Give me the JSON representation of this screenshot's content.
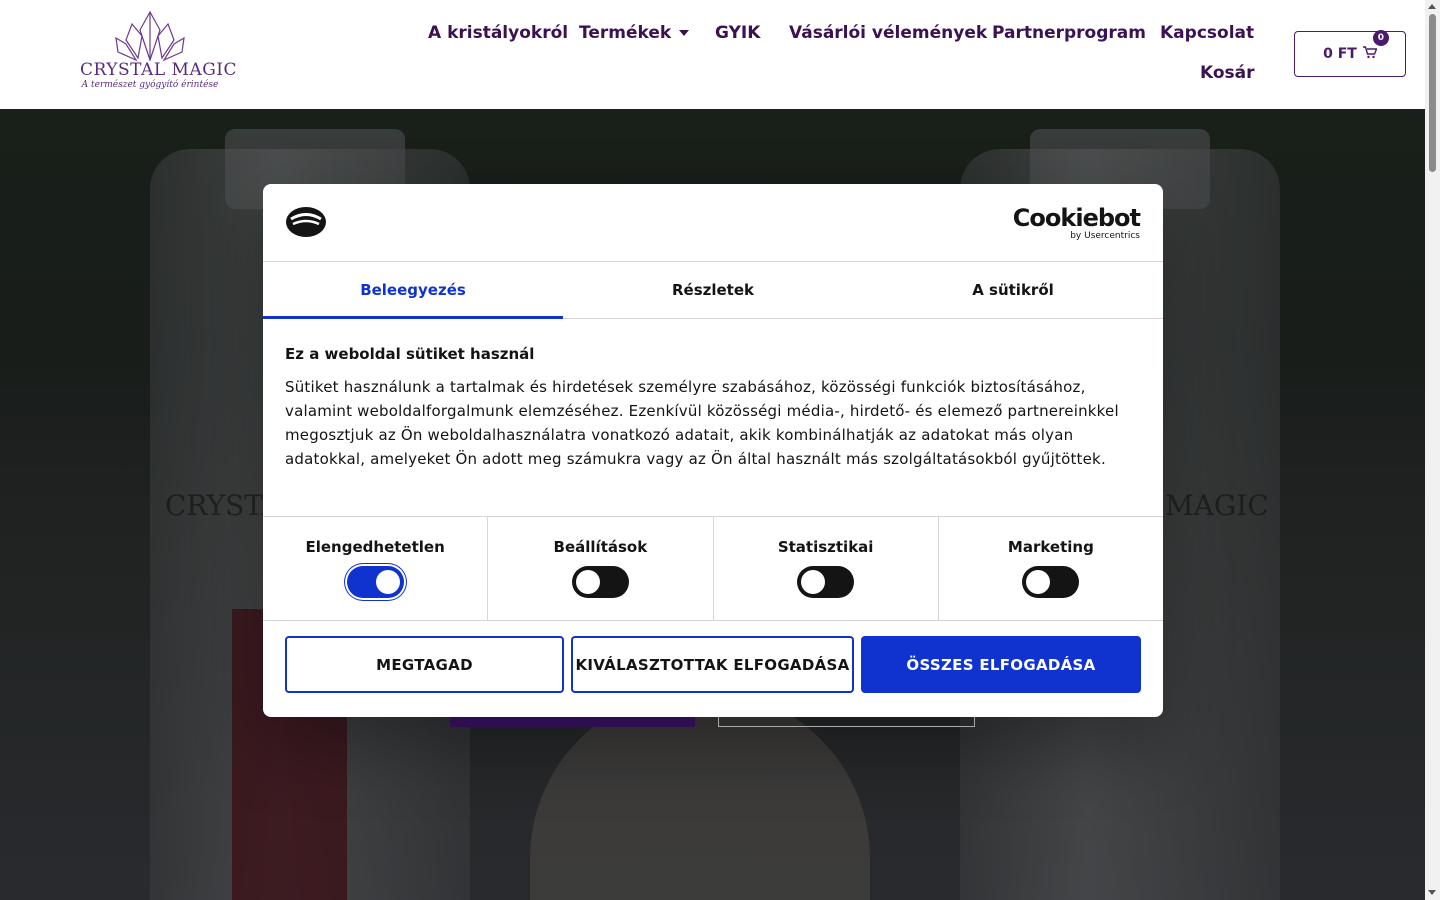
{
  "brand": {
    "name": "Crystal Magic",
    "tagline": "A természet gyógyító érintése"
  },
  "nav": {
    "items": [
      "A kristályokról",
      "Termékek",
      "GYIK",
      "Vásárlói vélemények",
      "Partnerprogram",
      "Kapcsolat",
      "Kosár"
    ]
  },
  "cart": {
    "amount": "0 FT",
    "count": "0"
  },
  "hero": {
    "watermark_left": "CRYSTAL",
    "watermark_right": "MAGIC"
  },
  "cookie_dialog": {
    "brand": "Cookiebot",
    "brand_by": "by Usercentrics",
    "tabs": [
      {
        "label": "Beleegyezés",
        "active": true
      },
      {
        "label": "Részletek",
        "active": false
      },
      {
        "label": "A sütikről",
        "active": false
      }
    ],
    "title": "Ez a weboldal sütiket használ",
    "text": "Sütiket használunk a tartalmak és hirdetések személyre szabásához, közösségi funkciók biztosításához, valamint weboldalforgalmunk elemzéséhez. Ezenkívül közösségi média-, hirdető- és elemező partnereinkkel megosztjuk az Ön weboldalhasználatra vonatkozó adatait, akik kombinálhatják az adatokat más olyan adatokkal, amelyeket Ön adott meg számukra vagy az Ön által használt más szolgáltatásokból gyűjtöttek.",
    "toggles": [
      {
        "label": "Elengedhetetlen",
        "on": true
      },
      {
        "label": "Beállítások",
        "on": false
      },
      {
        "label": "Statisztikai",
        "on": false
      },
      {
        "label": "Marketing",
        "on": false
      }
    ],
    "buttons": {
      "deny": "MEGTAGAD",
      "accept_selected": "KIVÁLASZTOTTAK ELFOGADÁSA",
      "accept_all": "ÖSSZES ELFOGADÁSA"
    },
    "accent_color": "#1032cf"
  },
  "colors": {
    "brand_purple": "#3a1252"
  }
}
